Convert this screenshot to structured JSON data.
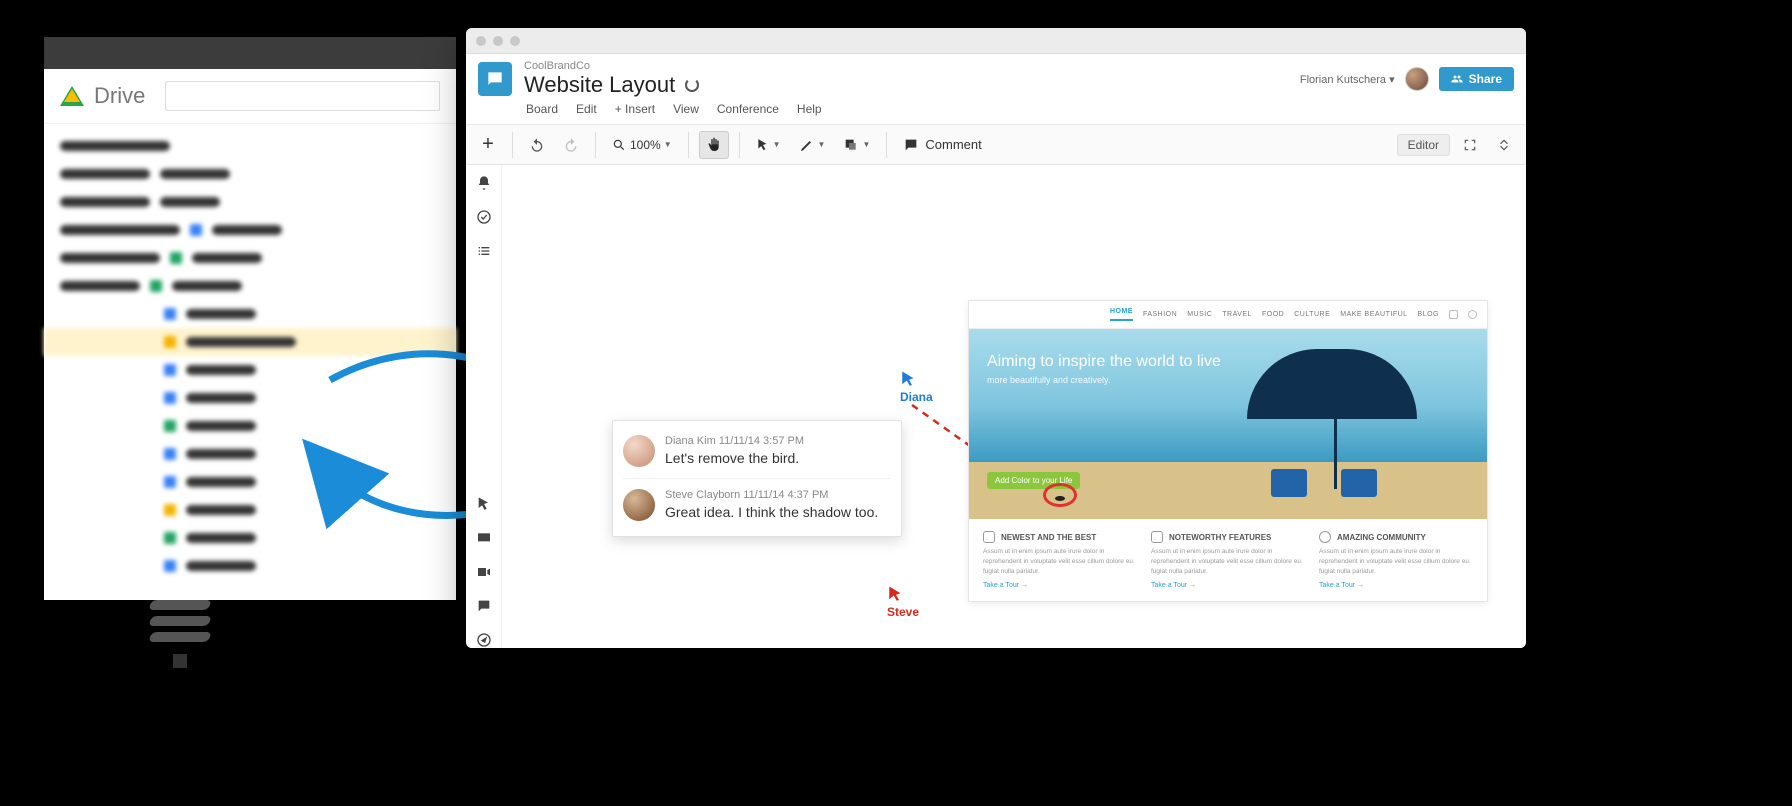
{
  "drive": {
    "title": "Drive"
  },
  "cb": {
    "brand": "CoolBrandCo",
    "title": "Website Layout",
    "user": "Florian Kutschera ▾",
    "share": "Share",
    "menu": {
      "board": "Board",
      "edit": "Edit",
      "insert": "+ Insert",
      "view": "View",
      "conference": "Conference",
      "help": "Help"
    },
    "toolbar": {
      "zoom": "100%",
      "comment": "Comment",
      "editor": "Editor"
    }
  },
  "cursors": {
    "diana": "Diana",
    "steve": "Steve"
  },
  "comments": [
    {
      "meta": "Diana Kim 11/11/14 3:57 PM",
      "text": "Let's remove the bird."
    },
    {
      "meta": "Steve Clayborn 11/11/14 4:37 PM",
      "text": "Great idea. I think the shadow too."
    }
  ],
  "mock": {
    "nav": [
      "HOME",
      "FASHION",
      "MUSIC",
      "TRAVEL",
      "FOOD",
      "CULTURE",
      "MAKE BEAUTIFUL",
      "BLOG"
    ],
    "hero_title": "Aiming to inspire the world to live",
    "hero_sub": "more beautifully and creatively.",
    "cta": "Add Color to your Life",
    "cols": [
      {
        "h": "NEWEST AND THE BEST",
        "p": "Assum ut in enim ipsum aute irure dolor in reprehenderit in voluptate velit esse cillum dolore eu fugiat nulla pariatur.",
        "link": "Take a Tour →"
      },
      {
        "h": "NOTEWORTHY FEATURES",
        "p": "Assum ut in enim ipsum aute irure dolor in reprehenderit in voluptate velit esse cillum dolore eu fugiat nulla pariatur.",
        "link": "Take a Tour →"
      },
      {
        "h": "AMAZING COMMUNITY",
        "p": "Assum ut in enim ipsum aute irure dolor in reprehenderit in voluptate velit esse cillum dolore eu fugiat nulla pariatur.",
        "link": "Take a Tour →"
      }
    ]
  }
}
